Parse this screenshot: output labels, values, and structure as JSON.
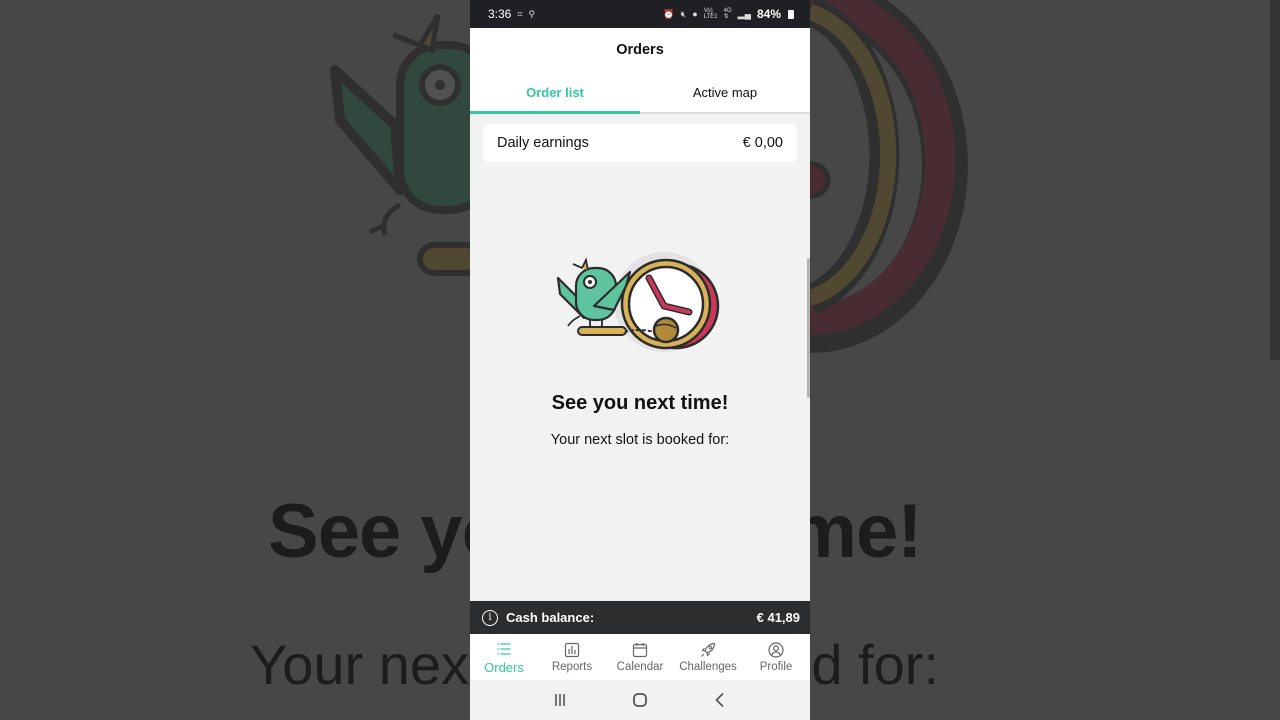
{
  "status_bar": {
    "time": "3:36",
    "battery": "84%",
    "left_icons": [
      "screenshot-icon",
      "location-icon"
    ],
    "right_icons": [
      "alarm-icon",
      "mute-icon",
      "location-icon",
      "volte-icon",
      "4g-icon",
      "signal-icon",
      "battery-icon"
    ]
  },
  "header": {
    "title": "Orders",
    "tabs": [
      {
        "label": "Order list",
        "active": true
      },
      {
        "label": "Active map",
        "active": false
      }
    ]
  },
  "earnings": {
    "label": "Daily earnings",
    "value": "€ 0,00"
  },
  "empty_state": {
    "title": "See you next time!",
    "subtitle": "Your next slot is booked for:",
    "illustration": "bird-chained-to-clock"
  },
  "cash_balance": {
    "label": "Cash balance:",
    "value": "€ 41,89",
    "icon": "info-icon"
  },
  "bottom_nav": [
    {
      "label": "Orders",
      "icon": "list-icon",
      "active": true
    },
    {
      "label": "Reports",
      "icon": "bar-chart-icon",
      "active": false
    },
    {
      "label": "Calendar",
      "icon": "calendar-icon",
      "active": false
    },
    {
      "label": "Challenges",
      "icon": "rocket-icon",
      "active": false
    },
    {
      "label": "Profile",
      "icon": "user-circle-icon",
      "active": false
    }
  ],
  "system_nav": [
    "recents-icon",
    "home-icon",
    "back-icon"
  ],
  "colors": {
    "accent": "#34c7a0",
    "cash_bar": "#2b2d2f",
    "clock_red": "#c8385a",
    "clock_gold": "#d8b25a",
    "bird_green": "#5ec49d"
  }
}
